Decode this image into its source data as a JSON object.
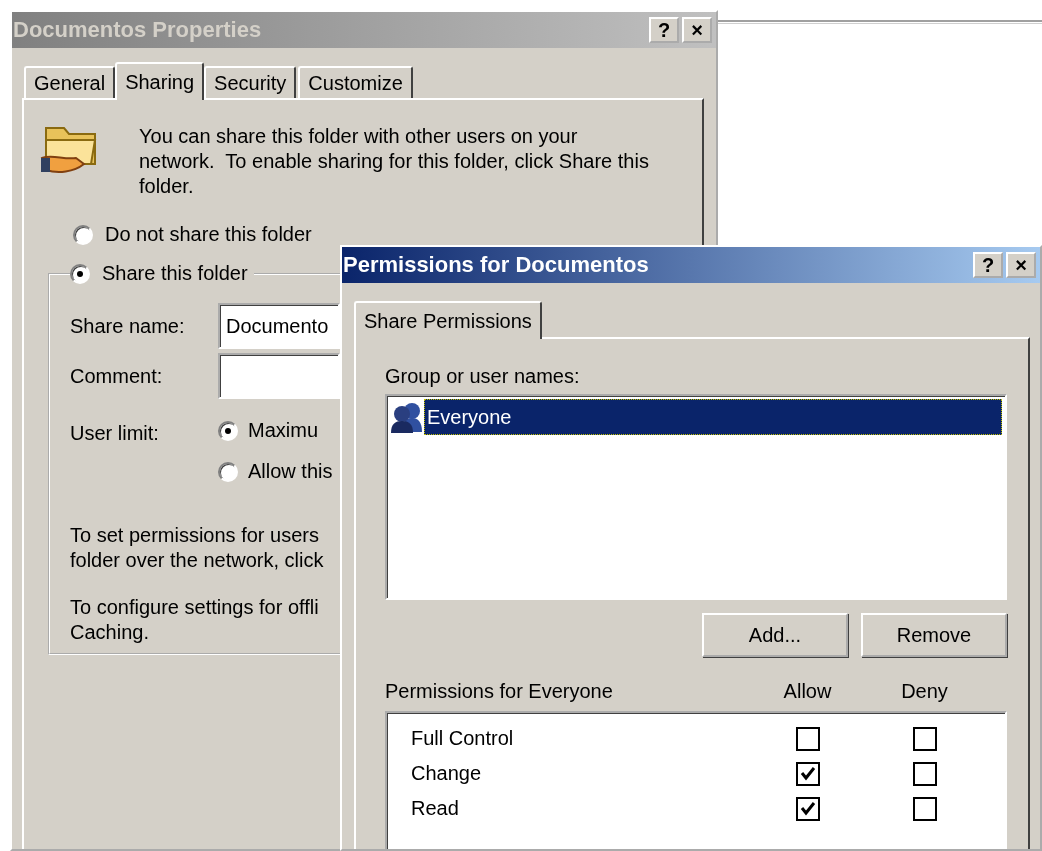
{
  "properties_window": {
    "title": "Documentos Properties",
    "active": false,
    "title_buttons": [
      "?",
      "×"
    ],
    "tabs": [
      {
        "label": "General",
        "selected": false
      },
      {
        "label": "Sharing",
        "selected": true
      },
      {
        "label": "Security",
        "selected": false
      },
      {
        "label": "Customize",
        "selected": false
      }
    ],
    "intro_lines": [
      "You can share this folder with other users on your",
      "network.  To enable sharing for this folder, click Share this",
      "folder."
    ],
    "share_options": [
      {
        "label": "Do not share this folder",
        "selected": false
      },
      {
        "label": "Share this folder",
        "selected": true
      }
    ],
    "fields": [
      {
        "label": "Share name:",
        "value": "Documento"
      },
      {
        "label": "Comment:"
      }
    ],
    "user_limit": {
      "label": "User limit:",
      "options": [
        {
          "label": "Maximu",
          "selected": true
        },
        {
          "label": "Allow this",
          "selected": false
        }
      ]
    },
    "notes": [
      {
        "lines": [
          "To set permissions for users",
          "folder over the network, click"
        ]
      },
      {
        "lines": [
          "To configure settings for offli",
          "Caching."
        ]
      }
    ]
  },
  "permissions_window": {
    "title": "Permissions for Documentos",
    "active": true,
    "title_buttons": [
      "?",
      "×"
    ],
    "tabs": [
      {
        "label": "Share Permissions",
        "selected": true
      }
    ],
    "group_label": "Group or user names:",
    "users": [
      {
        "name": "Everyone",
        "selected": true
      }
    ],
    "buttons": [
      "Add...",
      "Remove"
    ],
    "permissions_label": "Permissions for Everyone",
    "columns": [
      "Allow",
      "Deny"
    ],
    "permissions": [
      {
        "name": "Full Control",
        "allow": false,
        "deny": false
      },
      {
        "name": "Change",
        "allow": true,
        "deny": false
      },
      {
        "name": "Read",
        "allow": true,
        "deny": false
      }
    ]
  }
}
